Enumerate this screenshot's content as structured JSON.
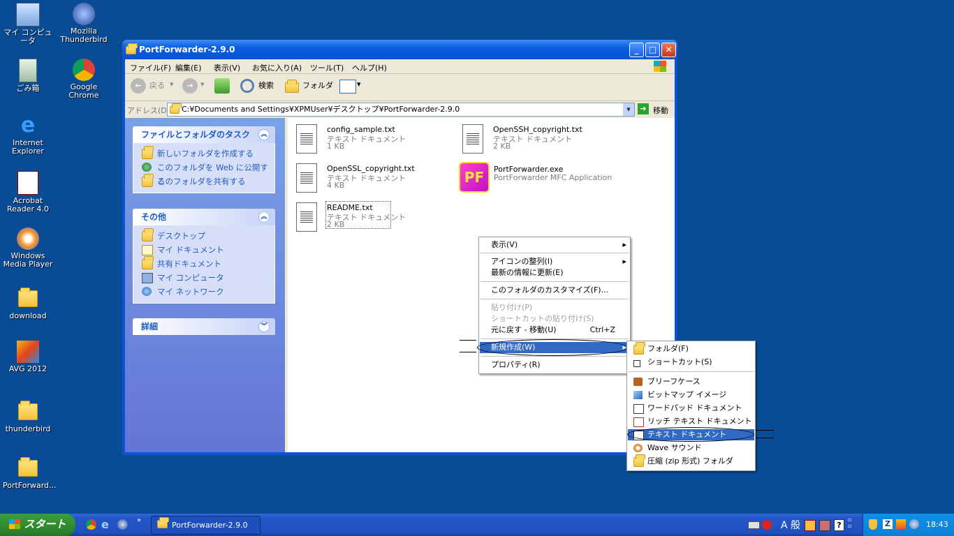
{
  "desktop": {
    "icons": [
      "マイ コンピュータ",
      "Mozilla Thunderbird",
      "ごみ箱",
      "Google Chrome",
      "Internet Explorer",
      "Acrobat Reader 4.0",
      "Windows Media Player",
      "download",
      "AVG 2012",
      "thunderbird",
      "PortForward..."
    ]
  },
  "window": {
    "title": "PortForwarder-2.9.0",
    "menu": [
      "ファイル(F)",
      "編集(E)",
      "表示(V)",
      "お気に入り(A)",
      "ツール(T)",
      "ヘルプ(H)"
    ],
    "toolbar": {
      "back": "戻る",
      "search": "検索",
      "folders": "フォルダ"
    },
    "address": {
      "label": "アドレス(D)",
      "value": "C:¥Documents and Settings¥XPMUser¥デスクトップ¥PortForwarder-2.9.0",
      "go": "移動"
    },
    "tasks": {
      "title": "ファイルとフォルダのタスク",
      "links": [
        "新しいフォルダを作成する",
        "このフォルダを Web に公開する",
        "このフォルダを共有する"
      ]
    },
    "other": {
      "title": "その他",
      "links": [
        "デスクトップ",
        "マイ ドキュメント",
        "共有ドキュメント",
        "マイ コンピュータ",
        "マイ ネットワーク"
      ]
    },
    "details": {
      "title": "詳細"
    },
    "files": [
      {
        "name": "config_sample.txt",
        "type": "テキスト ドキュメント",
        "size": "1 KB"
      },
      {
        "name": "OpenSSH_copyright.txt",
        "type": "テキスト ドキュメント",
        "size": "2 KB"
      },
      {
        "name": "OpenSSL_copyright.txt",
        "type": "テキスト ドキュメント",
        "size": "4 KB"
      },
      {
        "name": "PortForwarder.exe",
        "type": "PortForwarder MFC Application",
        "size": ""
      },
      {
        "name": "README.txt",
        "type": "テキスト ドキュメント",
        "size": "2 KB"
      }
    ]
  },
  "context_menu": {
    "items": [
      "表示(V)",
      "アイコンの整列(I)",
      "最新の情報に更新(E)",
      "このフォルダのカスタマイズ(F)...",
      "貼り付け(P)",
      "ショートカットの貼り付け(S)",
      "元に戻す - 移動(U)",
      "新規作成(W)",
      "プロパティ(R)"
    ],
    "undo_shortcut": "Ctrl+Z"
  },
  "submenu": {
    "items": [
      "フォルダ(F)",
      "ショートカット(S)",
      "ブリーフケース",
      "ビットマップ イメージ",
      "ワードパッド ドキュメント",
      "リッチ テキスト ドキュメント",
      "テキスト ドキュメント",
      "Wave サウンド",
      "圧縮 (zip 形式) フォルダ"
    ]
  },
  "taskbar": {
    "start": "スタート",
    "task": "PortForwarder-2.9.0",
    "ime": "A 般",
    "time": "18:43"
  },
  "colors": {
    "desktop": "#0a4b96",
    "titlebar": "#0a5ee2",
    "selection": "#316ac5",
    "start": "#2f8a2f"
  }
}
